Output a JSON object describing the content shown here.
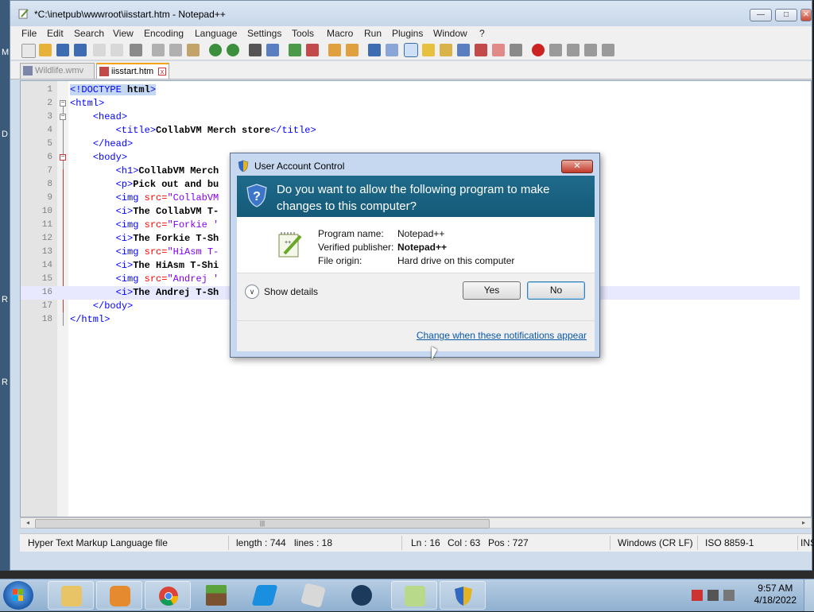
{
  "window": {
    "title": "*C:\\inetpub\\wwwroot\\iisstart.htm - Notepad++",
    "minimize": "—",
    "maximize": "□",
    "close": "✕"
  },
  "menu": [
    "File",
    "Edit",
    "Search",
    "View",
    "Encoding",
    "Language",
    "Settings",
    "Tools",
    "Macro",
    "Run",
    "Plugins",
    "Window",
    "?"
  ],
  "tabs": [
    {
      "label": "Wildlife.wmv",
      "active": false
    },
    {
      "label": "iisstart.htm",
      "active": true
    }
  ],
  "editor": {
    "lines": [
      {
        "n": "1",
        "code": "<!DOCTYPE html>"
      },
      {
        "n": "2",
        "code": "<html>"
      },
      {
        "n": "3",
        "code": "    <head>"
      },
      {
        "n": "4",
        "code": "        <title>CollabVM Merch store</title>"
      },
      {
        "n": "5",
        "code": "    </head>"
      },
      {
        "n": "6",
        "code": "    <body>"
      },
      {
        "n": "7",
        "code": "        <h1>CollabVM Merch"
      },
      {
        "n": "8",
        "code": "        <p>Pick out and bu"
      },
      {
        "n": "9",
        "code": "        <img src=\"CollabVM"
      },
      {
        "n": "10",
        "code": "        <i>The CollabVM T-"
      },
      {
        "n": "11",
        "code": "        <img src=\"Forkie '"
      },
      {
        "n": "12",
        "code": "        <i>The Forkie T-Sh                                          regular users)</i><br>"
      },
      {
        "n": "13",
        "code": "        <img src=\"HiAsm T-"
      },
      {
        "n": "14",
        "code": "        <i>The HiAsm T-Shi                                          else)</i><br>"
      },
      {
        "n": "15",
        "code": "        <img src=\"Andrej '"
      },
      {
        "n": "16",
        "code": "        <i>The Andrej T-Sh"
      },
      {
        "n": "17",
        "code": "    </body>"
      },
      {
        "n": "18",
        "code": "</html>"
      }
    ],
    "hscroll_grip": "|||"
  },
  "status": {
    "filetype": "Hyper Text Markup Language file",
    "length": "length : 744",
    "lines": "lines : 18",
    "ln": "Ln : 16",
    "col": "Col : 63",
    "pos": "Pos : 727",
    "eol": "Windows (CR LF)",
    "encoding": "ISO 8859-1",
    "mode": "INS"
  },
  "uac": {
    "title": "User Account Control",
    "close": "✕",
    "heading": "Do you want to allow the following program to make changes to this computer?",
    "program_name_label": "Program name:",
    "program_name": "Notepad++",
    "publisher_label": "Verified publisher:",
    "publisher": "Notepad++",
    "origin_label": "File origin:",
    "origin": "Hard drive on this computer",
    "show_details": "Show details",
    "yes": "Yes",
    "no": "No",
    "link": "Change when these notifications appear"
  },
  "desktop_labels": [
    "M",
    "D",
    "R",
    "R"
  ],
  "taskbar": {
    "time": "9:57 AM",
    "date": "4/18/2022"
  }
}
